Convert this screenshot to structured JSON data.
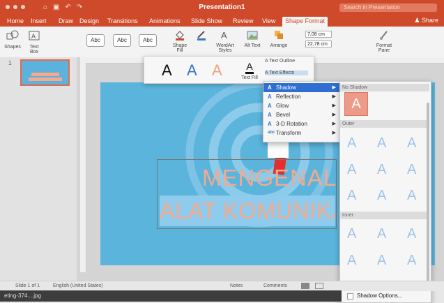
{
  "window": {
    "title": "Presentation1",
    "search_placeholder": "Search in Presentation",
    "share_label": "Share"
  },
  "tabs": [
    "Home",
    "Insert",
    "Draw",
    "Design",
    "Transitions",
    "Animations",
    "Slide Show",
    "Review",
    "View",
    "Shape Format"
  ],
  "active_tab": "Shape Format",
  "ribbon": {
    "shapes_label": "Shapes",
    "textbox_label": "Text Box",
    "style_samples": [
      "Abc",
      "Abc",
      "Abc"
    ],
    "shape_fill_label": "Shape Fill",
    "shape_outline_label": "Shape Outline",
    "wordart_label": "WordArt Styles",
    "alt_text_label": "Alt Text",
    "arrange_label": "Arrange",
    "height_value": "7,08 cm",
    "width_value": "22,78 cm",
    "format_pane_label": "Format Pane"
  },
  "wordart_gallery": {
    "samples": [
      "A",
      "A",
      "A"
    ],
    "text_fill_label": "Text Fill",
    "text_outline_label": "Text Outline",
    "text_effects_label": "Text Effects"
  },
  "effects_menu": [
    {
      "label": "Shadow",
      "icon": "A",
      "highlighted": true
    },
    {
      "label": "Reflection",
      "icon": "A",
      "highlighted": false
    },
    {
      "label": "Glow",
      "icon": "A",
      "highlighted": false
    },
    {
      "label": "Bevel",
      "icon": "A",
      "highlighted": false
    },
    {
      "label": "3-D Rotation",
      "icon": "A",
      "highlighted": false
    },
    {
      "label": "Transform",
      "icon": "abc",
      "highlighted": false
    }
  ],
  "shadow_submenu": {
    "no_shadow_label": "No Shadow",
    "outer_label": "Outer",
    "inner_label": "Inner",
    "options_label": "Shadow Options..."
  },
  "slide_panel": {
    "slide_number": "1"
  },
  "slide_text": {
    "line1": "MENGENAL",
    "line2": "ALAT KOMUNIKASI"
  },
  "statusbar": {
    "slide_info": "Slide 1 of 1",
    "language": "English (United States)",
    "notes_label": "Notes",
    "comments_label": "Comments"
  },
  "download": {
    "filename": "eting-374....jpg"
  },
  "colors": {
    "accent": "#cf4a2a",
    "slide_bg": "#5ab4dc",
    "text_orange": "#f4a98e",
    "menu_highlight": "#2f6fd1"
  }
}
